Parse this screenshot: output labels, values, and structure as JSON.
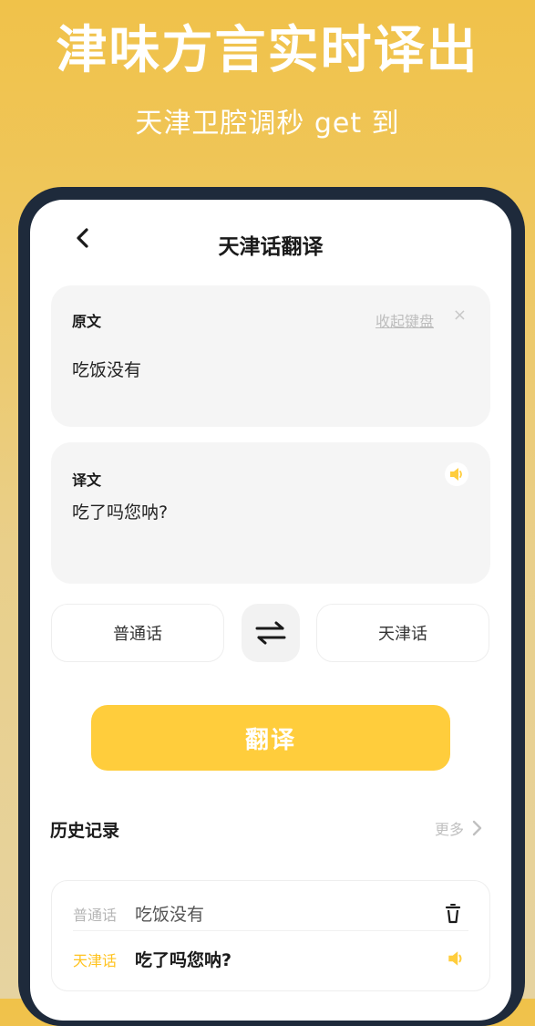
{
  "promo": {
    "title": "津味方言实时译出",
    "subtitle": "天津卫腔调秒 get 到"
  },
  "header": {
    "title": "天津话翻译"
  },
  "source": {
    "label": "原文",
    "collapse_keyboard": "收起键盘",
    "clear": "×",
    "text": "吃饭没有"
  },
  "target": {
    "label": "译文",
    "text": "吃了吗您呐?"
  },
  "languages": {
    "from": "普通话",
    "to": "天津话"
  },
  "translate_button": "翻译",
  "history": {
    "title": "历史记录",
    "more": "更多",
    "items": [
      {
        "source_lang": "普通话",
        "source_text": "吃饭没有",
        "target_lang": "天津话",
        "target_text": "吃了吗您呐?"
      }
    ]
  },
  "colors": {
    "accent": "#ffcd3c",
    "device_frame": "#1e2a3b"
  }
}
